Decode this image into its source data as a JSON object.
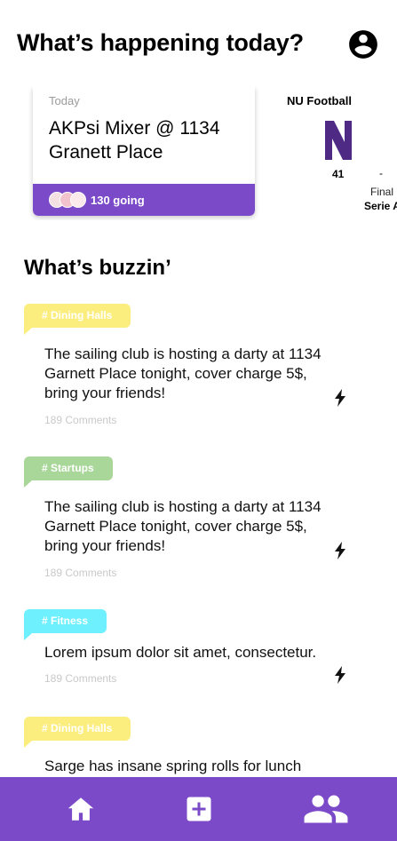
{
  "header": {
    "title": "What’s happening today?",
    "profile_icon": "account-circle-icon"
  },
  "events": [
    {
      "when": "Today",
      "title": "AKPsi Mixer @ 1134 Granett Place",
      "going": "130 going"
    }
  ],
  "game": {
    "title": "NU Football",
    "score": "41",
    "separator": "-",
    "status": "Final",
    "league": "Serie A"
  },
  "feed_title": "What’s buzzin’",
  "posts": [
    {
      "tag": "# Dining Halls",
      "text": "The sailing club is hosting a darty at 1134 Garnett Place tonight, cover charge 5$, bring your friends!",
      "comments": "189 Comments"
    },
    {
      "tag": "# Startups",
      "text": "The sailing club is hosting a darty at 1134 Garnett Place tonight, cover charge 5$, bring your friends!",
      "comments": "189 Comments"
    },
    {
      "tag": "# Fitness",
      "text": "Lorem ipsum dolor sit amet, consectetur.",
      "comments": "189 Comments"
    },
    {
      "tag": "# Dining Halls",
      "text": "Sarge has insane spring rolls for lunch",
      "comments": ""
    }
  ],
  "tag_colors": {
    "yellow": "#fbee7f",
    "green": "#a9d79a",
    "cyan": "#6ef0ff"
  },
  "nav": {
    "color": "#7b4ac8",
    "items": [
      "home-icon",
      "add-box-icon",
      "people-icon"
    ]
  }
}
